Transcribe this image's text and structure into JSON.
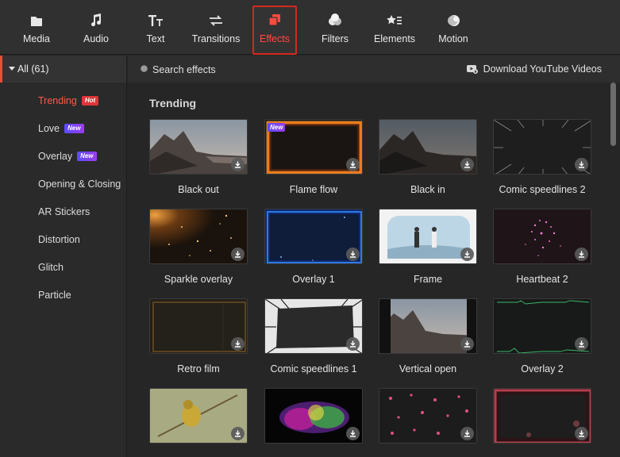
{
  "toolbar": {
    "tabs": [
      {
        "label": "Media",
        "icon": "folder-icon"
      },
      {
        "label": "Audio",
        "icon": "music-note-icon"
      },
      {
        "label": "Text",
        "icon": "text-icon"
      },
      {
        "label": "Transitions",
        "icon": "swap-arrows-icon"
      },
      {
        "label": "Effects",
        "icon": "effects-icon",
        "active": true
      },
      {
        "label": "Filters",
        "icon": "filters-icon"
      },
      {
        "label": "Elements",
        "icon": "elements-icon"
      },
      {
        "label": "Motion",
        "icon": "motion-icon"
      }
    ],
    "accent_color": "#ff4b3e"
  },
  "sidebar": {
    "all_label": "All (61)",
    "items": [
      {
        "label": "Trending",
        "badge": "Hot",
        "selected": true
      },
      {
        "label": "Love",
        "badge": "New"
      },
      {
        "label": "Overlay",
        "badge": "New"
      },
      {
        "label": "Opening & Closing"
      },
      {
        "label": "AR Stickers"
      },
      {
        "label": "Distortion"
      },
      {
        "label": "Glitch"
      },
      {
        "label": "Particle"
      }
    ]
  },
  "search": {
    "placeholder": "Search effects"
  },
  "youtube_link": "Download YouTube Videos",
  "section_title": "Trending",
  "effects": [
    {
      "name": "Black out",
      "thumb": "mountain"
    },
    {
      "name": "Flame flow",
      "thumb": "flame",
      "badge": "New"
    },
    {
      "name": "Black in",
      "thumb": "mountain-dark"
    },
    {
      "name": "Comic speedlines 2",
      "thumb": "speedlines"
    },
    {
      "name": "Sparkle overlay",
      "thumb": "sparkle"
    },
    {
      "name": "Overlay 1",
      "thumb": "blue-frame"
    },
    {
      "name": "Frame",
      "thumb": "couple"
    },
    {
      "name": "Heartbeat 2",
      "thumb": "heart-particles"
    },
    {
      "name": "Retro film",
      "thumb": "retro"
    },
    {
      "name": "Comic speedlines 1",
      "thumb": "speedlines-frame"
    },
    {
      "name": "Vertical open",
      "thumb": "vertical-open"
    },
    {
      "name": "Overlay 2",
      "thumb": "green-lines"
    },
    {
      "name": "",
      "thumb": "bird"
    },
    {
      "name": "",
      "thumb": "rainbow-glow"
    },
    {
      "name": "",
      "thumb": "hearts"
    },
    {
      "name": "",
      "thumb": "red-glow"
    }
  ]
}
